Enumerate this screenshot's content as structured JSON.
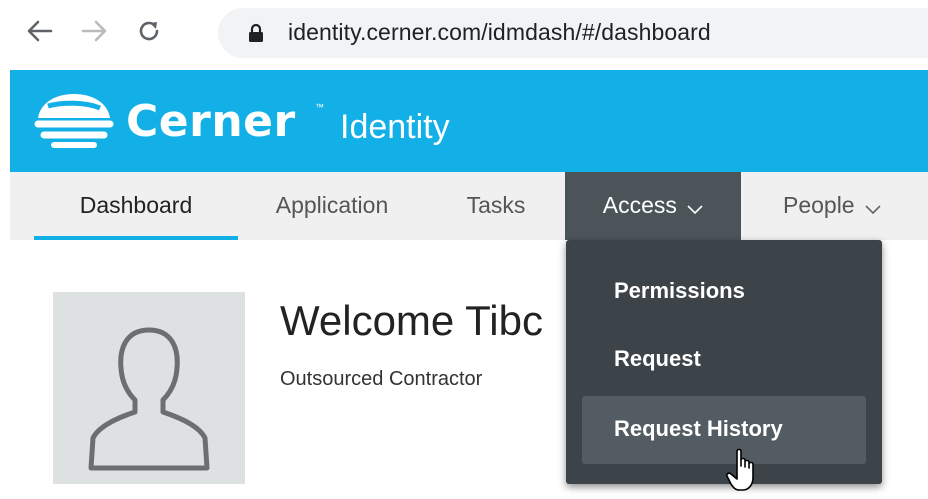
{
  "browser": {
    "url": "identity.cerner.com/idmdash/#/dashboard",
    "icons": [
      "back-arrow-icon",
      "forward-arrow-icon",
      "reload-icon",
      "lock-icon"
    ]
  },
  "header": {
    "brand": "Cerner",
    "trademark": "™",
    "product": "Identity",
    "logo_icon": "cerner-logo-icon",
    "background_color": "#12b0e6"
  },
  "nav": {
    "items": [
      {
        "label": "Dashboard",
        "active": true
      },
      {
        "label": "Application"
      },
      {
        "label": "Tasks"
      },
      {
        "label": "Access",
        "has_dropdown": true,
        "open": true
      },
      {
        "label": "People",
        "has_dropdown": true
      }
    ]
  },
  "main": {
    "welcome_text": "Welcome Tibc",
    "role": "Outsourced Contractor",
    "avatar_icon": "user-silhouette-icon"
  },
  "access_menu": {
    "items": [
      {
        "label": "Permissions"
      },
      {
        "label": "Request"
      },
      {
        "label": "Request History",
        "hovered": true
      }
    ]
  },
  "colors": {
    "accent": "#12b0e6",
    "nav_bg": "#f0f0f0",
    "active_menu_bg": "#4a5459",
    "dropdown_bg": "#3c4449"
  }
}
